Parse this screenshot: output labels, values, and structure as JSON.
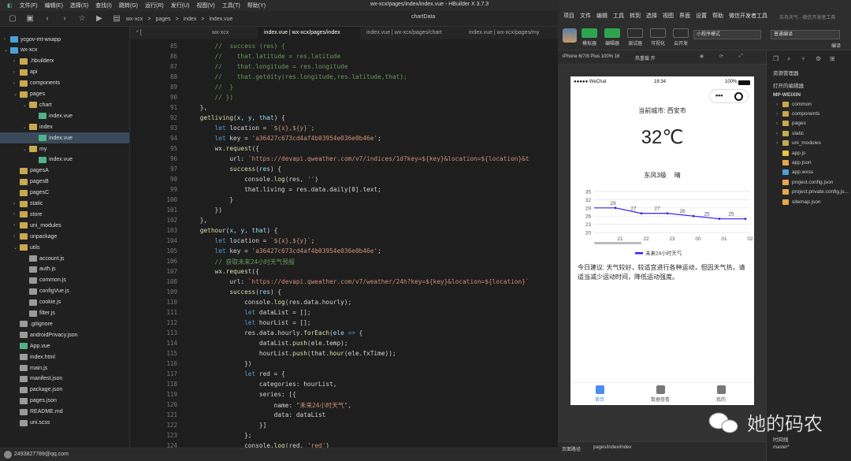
{
  "hb": {
    "menus": [
      "文件(F)",
      "编辑(E)",
      "选择(S)",
      "查找(I)",
      "跳转(G)",
      "运行(R)",
      "发行(U)",
      "视图(V)",
      "工具(T)",
      "帮助(Y)"
    ],
    "title": "wx-xcx/pages/index/index.vue - HBuilder X 3.7.3",
    "breadcrumb": [
      "wx-xcx",
      ">",
      "pages",
      ">",
      "index",
      ">",
      "index.vue"
    ],
    "chartdata_tab": "chartData",
    "tree": [
      {
        "label": "ycgov-mt-wxapp",
        "depth": 0,
        "arrow": "›",
        "type": "proj"
      },
      {
        "label": "wx-xcx",
        "depth": 0,
        "arrow": "⌄",
        "type": "proj"
      },
      {
        "label": ".hbuilderx",
        "depth": 1,
        "arrow": "›",
        "type": "fold"
      },
      {
        "label": "api",
        "depth": 1,
        "arrow": "›",
        "type": "fold"
      },
      {
        "label": "components",
        "depth": 1,
        "arrow": "›",
        "type": "fold"
      },
      {
        "label": "pages",
        "depth": 1,
        "arrow": "⌄",
        "type": "fold"
      },
      {
        "label": "chart",
        "depth": 2,
        "arrow": "⌄",
        "type": "fold"
      },
      {
        "label": "index.vue",
        "depth": 3,
        "arrow": "",
        "type": "vue"
      },
      {
        "label": "index",
        "depth": 2,
        "arrow": "⌄",
        "type": "fold"
      },
      {
        "label": "index.vue",
        "depth": 3,
        "arrow": "",
        "type": "vue",
        "sel": true
      },
      {
        "label": "my",
        "depth": 2,
        "arrow": "⌄",
        "type": "fold"
      },
      {
        "label": "index.vue",
        "depth": 3,
        "arrow": "",
        "type": "vue"
      },
      {
        "label": "pagesA",
        "depth": 1,
        "arrow": "",
        "type": "fold"
      },
      {
        "label": "pagesB",
        "depth": 1,
        "arrow": "",
        "type": "fold"
      },
      {
        "label": "pagesC",
        "depth": 1,
        "arrow": "",
        "type": "fold"
      },
      {
        "label": "static",
        "depth": 1,
        "arrow": "›",
        "type": "fold"
      },
      {
        "label": "store",
        "depth": 1,
        "arrow": "›",
        "type": "fold"
      },
      {
        "label": "uni_modules",
        "depth": 1,
        "arrow": "›",
        "type": "fold"
      },
      {
        "label": "unpackage",
        "depth": 1,
        "arrow": "›",
        "type": "fold"
      },
      {
        "label": "utils",
        "depth": 1,
        "arrow": "⌄",
        "type": "fold"
      },
      {
        "label": "account.js",
        "depth": 2,
        "arrow": "",
        "type": "file"
      },
      {
        "label": "auth.js",
        "depth": 2,
        "arrow": "",
        "type": "file"
      },
      {
        "label": "common.js",
        "depth": 2,
        "arrow": "",
        "type": "file"
      },
      {
        "label": "configVue.js",
        "depth": 2,
        "arrow": "",
        "type": "file"
      },
      {
        "label": "cookie.js",
        "depth": 2,
        "arrow": "",
        "type": "file"
      },
      {
        "label": "filter.js",
        "depth": 2,
        "arrow": "",
        "type": "file"
      },
      {
        "label": ".gitignore",
        "depth": 1,
        "arrow": "",
        "type": "file"
      },
      {
        "label": "androidPrivacy.json",
        "depth": 1,
        "arrow": "",
        "type": "file"
      },
      {
        "label": "App.vue",
        "depth": 1,
        "arrow": "",
        "type": "vue"
      },
      {
        "label": "index.html",
        "depth": 1,
        "arrow": "",
        "type": "file"
      },
      {
        "label": "main.js",
        "depth": 1,
        "arrow": "",
        "type": "file"
      },
      {
        "label": "manifest.json",
        "depth": 1,
        "arrow": "",
        "type": "file"
      },
      {
        "label": "package.json",
        "depth": 1,
        "arrow": "",
        "type": "file"
      },
      {
        "label": "pages.json",
        "depth": 1,
        "arrow": "",
        "type": "file"
      },
      {
        "label": "README.md",
        "depth": 1,
        "arrow": "",
        "type": "file"
      },
      {
        "label": "uni.scss",
        "depth": 1,
        "arrow": "",
        "type": "file"
      }
    ],
    "tabs": [
      "* [",
      "wx-xcx",
      "index.vue | wx-xcx/pages/index",
      "index.vue | wx-xcx/pages/chart",
      "index.vue | wx-xcx/pages/my"
    ],
    "status_user": "2493827789@qq.com",
    "code_lines": [
      {
        "n": "85",
        "t": [
          [
            "c",
            "        //  success (res) {"
          ]
        ]
      },
      {
        "n": "86",
        "t": [
          [
            "c",
            "        //    that.latitude = res.latitude"
          ]
        ]
      },
      {
        "n": "87",
        "t": [
          [
            "c",
            "        //    that.longitude = res.longitude"
          ]
        ]
      },
      {
        "n": "88",
        "t": [
          [
            "c",
            "        //    that.getdity(res.longitude,res.latitude,that);"
          ]
        ]
      },
      {
        "n": "89",
        "t": [
          [
            "c",
            "        //  }"
          ]
        ]
      },
      {
        "n": "90",
        "t": [
          [
            "c",
            "        // })"
          ]
        ]
      },
      {
        "n": "91",
        "t": [
          [
            "",
            "    },"
          ]
        ]
      },
      {
        "n": "92",
        "t": [
          [
            "f",
            "    getliving"
          ],
          [
            "",
            "("
          ],
          [
            "v",
            "x"
          ],
          [
            "",
            ", "
          ],
          [
            "v",
            "y"
          ],
          [
            "",
            ", "
          ],
          [
            "v",
            "that"
          ],
          [
            "",
            ") {"
          ]
        ]
      },
      {
        "n": "93",
        "t": [
          [
            "k",
            "        let "
          ],
          [
            "",
            "location = "
          ],
          [
            "s",
            "`${x},${y}`"
          ],
          [
            "",
            ";"
          ]
        ]
      },
      {
        "n": "94",
        "t": [
          [
            "k",
            "        let "
          ],
          [
            "",
            "key = "
          ],
          [
            "s",
            "'a36427c673cd4af4b03954e036e0b46e'"
          ],
          [
            "",
            ";"
          ]
        ]
      },
      {
        "n": "95",
        "t": [
          [
            "",
            "        wx."
          ],
          [
            "f",
            "request"
          ],
          [
            "",
            "({"
          ]
        ]
      },
      {
        "n": "96",
        "t": [
          [
            "",
            "            url: "
          ],
          [
            "s",
            "`https://devapi.qweather.com/v7/indices/1d?key=${key}&location=${location}&t"
          ]
        ]
      },
      {
        "n": "97",
        "t": [
          [
            "f",
            "            success"
          ],
          [
            "",
            "("
          ],
          [
            "v",
            "res"
          ],
          [
            "",
            ") {"
          ]
        ]
      },
      {
        "n": "98",
        "t": [
          [
            "",
            "                console."
          ],
          [
            "f",
            "log"
          ],
          [
            "",
            "(res, "
          ],
          [
            "s",
            "''"
          ],
          [
            "",
            ")"
          ]
        ]
      },
      {
        "n": "99",
        "t": [
          [
            "",
            "                that.living = res.data.daily[0].text;"
          ]
        ]
      },
      {
        "n": "100",
        "t": [
          [
            "",
            "            }"
          ]
        ]
      },
      {
        "n": "101",
        "t": [
          [
            "",
            "        })"
          ]
        ]
      },
      {
        "n": "102",
        "t": [
          [
            "",
            "    },"
          ]
        ]
      },
      {
        "n": "103",
        "t": [
          [
            "f",
            "    gethour"
          ],
          [
            "",
            "("
          ],
          [
            "v",
            "x"
          ],
          [
            "",
            ", "
          ],
          [
            "v",
            "y"
          ],
          [
            "",
            ", "
          ],
          [
            "v",
            "that"
          ],
          [
            "",
            ") {"
          ]
        ]
      },
      {
        "n": "104",
        "t": [
          [
            "k",
            "        let "
          ],
          [
            "",
            "location = "
          ],
          [
            "s",
            "`${x},${y}`"
          ],
          [
            "",
            ";"
          ]
        ]
      },
      {
        "n": "105",
        "t": [
          [
            "k",
            "        let "
          ],
          [
            "",
            "key = "
          ],
          [
            "s",
            "'a36427c673cd4af4b03954e036e0b46e'"
          ],
          [
            "",
            ";"
          ]
        ]
      },
      {
        "n": "106",
        "t": [
          [
            "c",
            "        // 获取未来24小时天气预报"
          ]
        ]
      },
      {
        "n": "107",
        "t": [
          [
            "",
            "        wx."
          ],
          [
            "f",
            "request"
          ],
          [
            "",
            "({"
          ]
        ]
      },
      {
        "n": "108",
        "t": [
          [
            "",
            "            url: "
          ],
          [
            "s",
            "`https://devapi.qweather.com/v7/weather/24h?key=${key}&location=${location}`"
          ]
        ]
      },
      {
        "n": "109",
        "t": [
          [
            "f",
            "            success"
          ],
          [
            "",
            "("
          ],
          [
            "v",
            "res"
          ],
          [
            "",
            ") {"
          ]
        ]
      },
      {
        "n": "110",
        "t": [
          [
            "",
            "                console."
          ],
          [
            "f",
            "log"
          ],
          [
            "",
            "(res.data.hourly);"
          ]
        ]
      },
      {
        "n": "111",
        "t": [
          [
            "k",
            "                let "
          ],
          [
            "",
            "dataList = [];"
          ]
        ]
      },
      {
        "n": "112",
        "t": [
          [
            "k",
            "                let "
          ],
          [
            "",
            "hourList = [];"
          ]
        ]
      },
      {
        "n": "113",
        "t": [
          [
            "",
            "                res.data.hourly."
          ],
          [
            "f",
            "forEach"
          ],
          [
            "",
            "("
          ],
          [
            "v",
            "ele"
          ],
          [
            "k",
            " => "
          ],
          [
            "",
            "{"
          ]
        ]
      },
      {
        "n": "114",
        "t": [
          [
            "",
            "                    dataList."
          ],
          [
            "f",
            "push"
          ],
          [
            "",
            "(ele.temp);"
          ]
        ]
      },
      {
        "n": "115",
        "t": [
          [
            "",
            "                    hourList."
          ],
          [
            "f",
            "push"
          ],
          [
            "",
            "(that."
          ],
          [
            "f",
            "hour"
          ],
          [
            "",
            "(ele.fxTime));"
          ]
        ]
      },
      {
        "n": "116",
        "t": [
          [
            "",
            "                })"
          ]
        ]
      },
      {
        "n": "117",
        "t": [
          [
            "k",
            "                let "
          ],
          [
            "",
            "red = {"
          ]
        ]
      },
      {
        "n": "118",
        "t": [
          [
            "",
            "                    categories: hourList,"
          ]
        ]
      },
      {
        "n": "119",
        "t": [
          [
            "",
            "                    series: [{"
          ]
        ]
      },
      {
        "n": "120",
        "t": [
          [
            "",
            "                        name: "
          ],
          [
            "s",
            "\"未来24小时天气\""
          ],
          [
            "",
            ","
          ]
        ]
      },
      {
        "n": "121",
        "t": [
          [
            "",
            "                        data: dataList"
          ]
        ]
      },
      {
        "n": "122",
        "t": [
          [
            "",
            "                    }]"
          ]
        ]
      },
      {
        "n": "123",
        "t": [
          [
            "",
            "                };"
          ]
        ]
      },
      {
        "n": "124",
        "t": [
          [
            "",
            "                console."
          ],
          [
            "f",
            "log"
          ],
          [
            "",
            "(red, "
          ],
          [
            "s",
            "'red'"
          ],
          [
            "",
            ")"
          ]
        ]
      }
    ]
  },
  "wx": {
    "menus": [
      "项目",
      "文件",
      "编辑",
      "工具",
      "转到",
      "选择",
      "视图",
      "界面",
      "设置",
      "帮助",
      "微信开发者工具"
    ],
    "title": "苏冉天气 - 微信开发者工具",
    "toolbar": [
      {
        "label": "模拟器",
        "color": "#2ea44f"
      },
      {
        "label": "编辑器",
        "color": "#2ea44f"
      },
      {
        "label": "调试器",
        "color": ""
      },
      {
        "label": "可视化",
        "color": ""
      },
      {
        "label": "云开发",
        "color": ""
      }
    ],
    "mode_select": "小程序模式",
    "compile_select": "普通编译",
    "compile_label": "编译",
    "device": "iPhone 6/7/8 Plus 100% 16",
    "hotreload": "热重载 开",
    "phone": {
      "carrier": "●●●●● WeChat",
      "time": "18:34",
      "battery": "100%",
      "city": "当前城市: 西安市",
      "temp": "32℃",
      "wind": "东风3级",
      "weather": "晴",
      "advice": "今日建议: 天气较好，较适宜进行各种运动，但因天气热，请适当减少运动时间，降低运动强度。",
      "tabs": [
        "首页",
        "数据查看",
        "我的"
      ]
    },
    "page_path_label": "页面路径",
    "page_path": "pages/index/index",
    "resource": {
      "title": "资源管理器",
      "open_label": "打开的编辑器",
      "root": "MP-WEIXIN",
      "items": [
        {
          "label": "common",
          "type": "fold"
        },
        {
          "label": "components",
          "type": "fold"
        },
        {
          "label": "pages",
          "type": "fold"
        },
        {
          "label": "static",
          "type": "fold"
        },
        {
          "label": "uni_modules",
          "type": "fold"
        },
        {
          "label": "app.js",
          "type": "js"
        },
        {
          "label": "app.json",
          "type": "json"
        },
        {
          "label": "app.wxss",
          "type": "wxss"
        },
        {
          "label": "project.config.json",
          "type": "json"
        },
        {
          "label": "project.private.config.js...",
          "type": "json"
        },
        {
          "label": "sitemap.json",
          "type": "json"
        }
      ],
      "timeline": "时间线",
      "branch": "master*"
    },
    "watermark": "她的码农"
  },
  "chart_data": {
    "type": "line",
    "categories": [
      "21",
      "22",
      "23",
      "00",
      "01",
      "02"
    ],
    "x_all": [
      "20",
      "21",
      "22",
      "23",
      "00",
      "01",
      "02"
    ],
    "values": [
      29,
      27,
      27,
      26,
      25,
      25
    ],
    "ylim": [
      20,
      35
    ],
    "yticks": [
      20,
      23,
      26,
      29,
      32,
      35
    ],
    "series_name": "未来24小时天气",
    "color": "#3d1df0"
  }
}
